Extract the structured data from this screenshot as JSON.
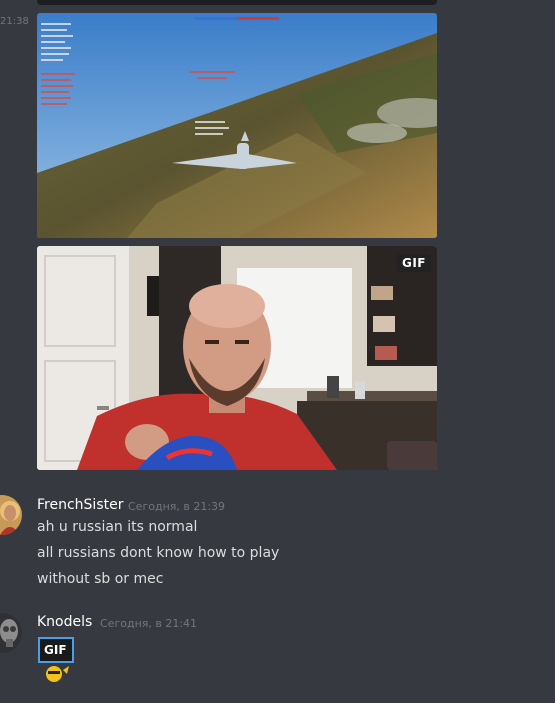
{
  "message_timestamps": {
    "first": "21:38"
  },
  "messages": [
    {
      "author": "FrenchSister",
      "time": "Сегодня, в 21:39",
      "lines": [
        "ah u russian its normal",
        "all russians dont know how to play",
        "without sb or mec"
      ]
    },
    {
      "author": "Knodels",
      "time": "Сегодня, в 21:41",
      "gif_label": "GIF"
    }
  ],
  "embeds": {
    "gif_badge": "GIF"
  },
  "colors": {
    "background": "#36393f",
    "author": "#ffffff",
    "timestamp": "#72767d",
    "text": "#dcddde"
  },
  "icons": [
    "jesus-avatar-icon",
    "gas-mask-avatar-icon",
    "gif-sticker-icon"
  ]
}
